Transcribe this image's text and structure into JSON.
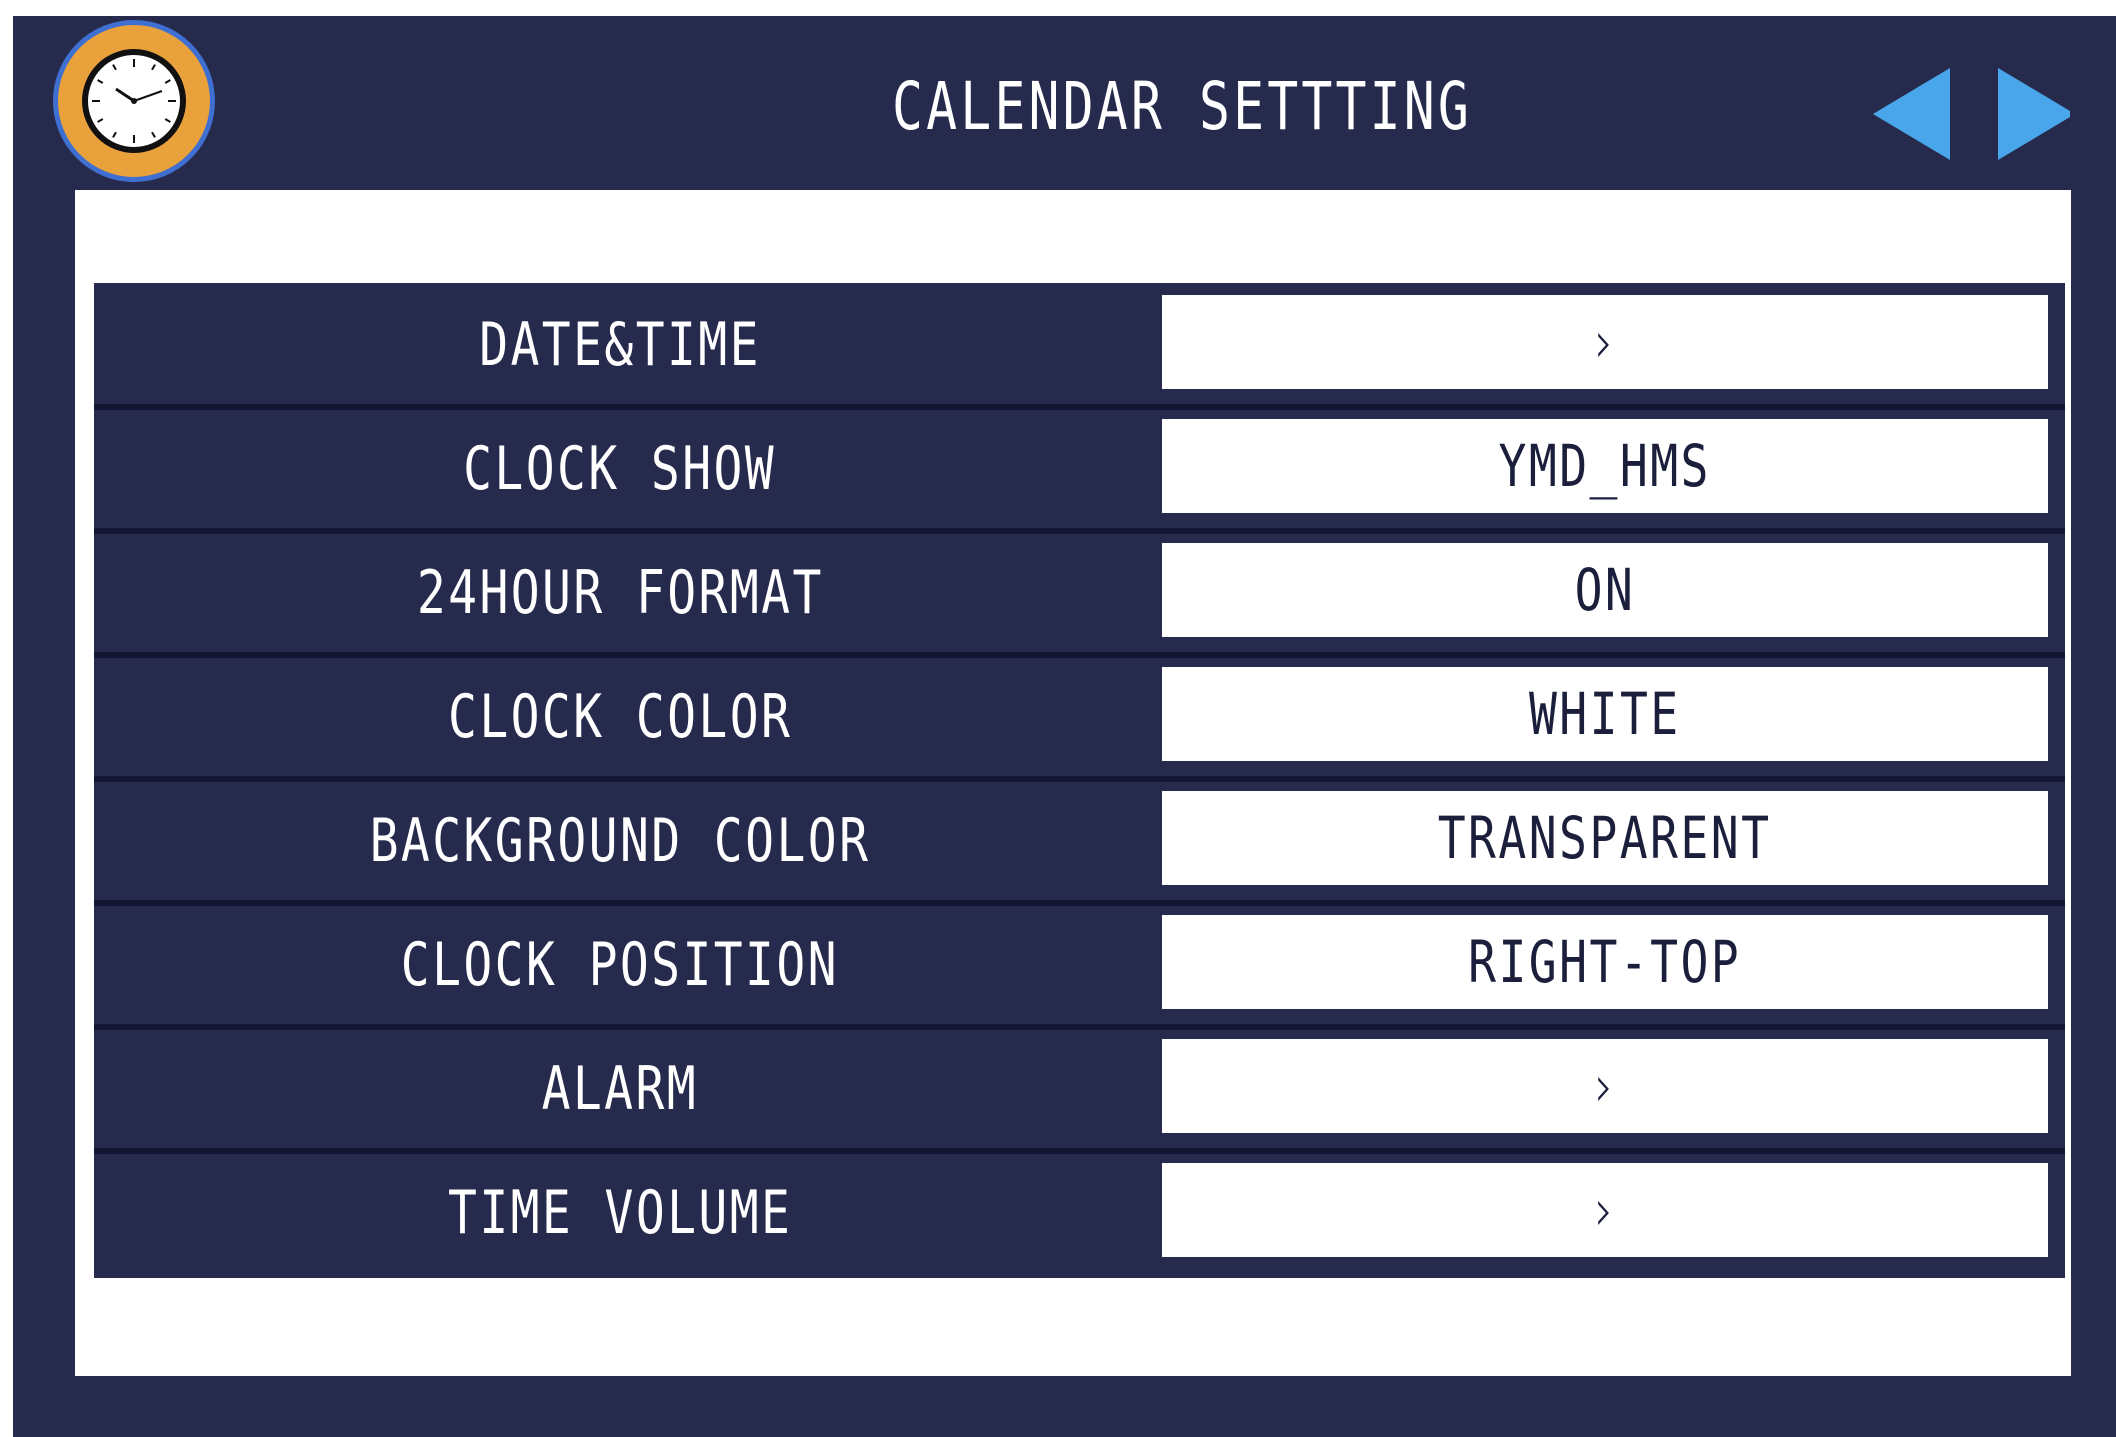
{
  "header": {
    "title": "CALENDAR SETTTING",
    "icons": {
      "clock": "clock-icon",
      "prev": "triangle-left-icon",
      "next": "triangle-right-icon"
    }
  },
  "colors": {
    "background": "#262b4d",
    "panel": "#ffffff",
    "badge_fill": "#e9a23b",
    "badge_ring": "#3f6fd1",
    "arrow": "#4aa6ea",
    "value_text": "#1b1f3c"
  },
  "settings": [
    {
      "label": "DATE&TIME",
      "value": "›"
    },
    {
      "label": "CLOCK SHOW",
      "value": "YMD_HMS"
    },
    {
      "label": "24HOUR FORMAT",
      "value": "ON"
    },
    {
      "label": "CLOCK COLOR",
      "value": "WHITE"
    },
    {
      "label": "BACKGROUND COLOR",
      "value": "TRANSPARENT"
    },
    {
      "label": "CLOCK POSITION",
      "value": "RIGHT-TOP"
    },
    {
      "label": "ALARM",
      "value": "›"
    },
    {
      "label": "TIME VOLUME",
      "value": "›"
    }
  ]
}
